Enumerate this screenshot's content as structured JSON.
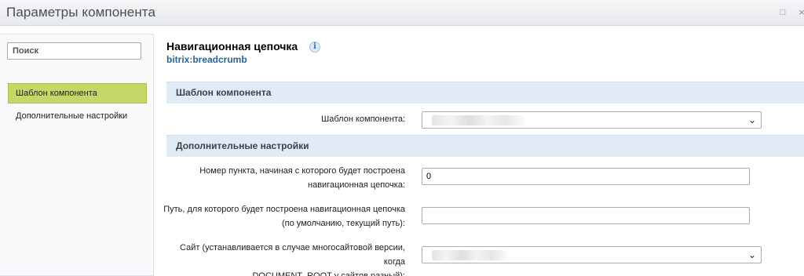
{
  "window": {
    "title": "Параметры компонента",
    "maximize_glyph": "□",
    "close_glyph": "×"
  },
  "sidebar": {
    "search_placeholder": "Поиск",
    "items": [
      {
        "label": "Шаблон компонента",
        "active": true
      },
      {
        "label": "Дополнительные настройки",
        "active": false
      }
    ]
  },
  "component": {
    "title": "Навигационная цепочка",
    "info_glyph": "i",
    "code": "bitrix:breadcrumb"
  },
  "sections": [
    {
      "header": "Шаблон компонента",
      "fields": [
        {
          "label": "Шаблон компонента:",
          "type": "select",
          "value": ""
        }
      ]
    },
    {
      "header": "Дополнительные настройки",
      "fields": [
        {
          "label_line1": "Номер пункта, начиная с которого будет построена",
          "label_line2": "навигационная цепочка:",
          "type": "input",
          "value": "0"
        },
        {
          "label_line1": "Путь, для которого будет построена навигационная цепочка",
          "label_line2": "(по умолчанию, текущий путь):",
          "type": "input",
          "value": ""
        },
        {
          "label_line1": "Сайт (устанавливается в случае многосайтовой версии, когда",
          "label_line2": "DOCUMENT_ROOT у сайтов разный):",
          "type": "select",
          "value": ""
        }
      ]
    }
  ],
  "icons": {
    "chevron": "chevron-down-icon",
    "info": "info-icon"
  },
  "colors": {
    "active_nav": "#c4d86a",
    "section_header_bg": "#e0ebf6",
    "code_link": "#2a6496"
  }
}
